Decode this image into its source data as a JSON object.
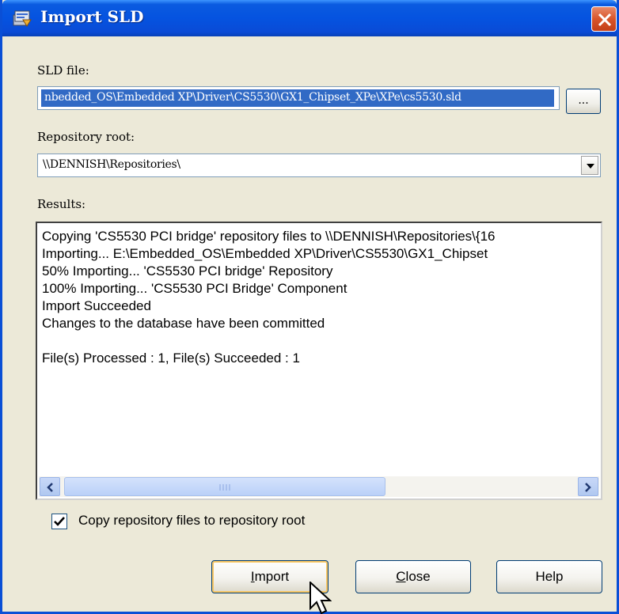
{
  "window": {
    "title": "Import SLD",
    "title_icon": "import-sld-icon",
    "close_icon": "close-icon"
  },
  "sld_file": {
    "label": "SLD file:",
    "value": "nbedded_OS\\Embedded XP\\Driver\\CS5530\\GX1_Chipset_XPe\\XPe\\cs5530.sld",
    "browse_label": "..."
  },
  "repository_root": {
    "label": "Repository root:",
    "value": "\\\\DENNISH\\Repositories\\"
  },
  "results": {
    "label": "Results:",
    "lines": [
      "Copying 'CS5530 PCI bridge' repository files to \\\\DENNISH\\Repositories\\{16",
      "Importing...  E:\\Embedded_OS\\Embedded XP\\Driver\\CS5530\\GX1_Chipset",
      "50% Importing...  'CS5530 PCI bridge' Repository",
      "100% Importing...  'CS5530 PCI Bridge' Component",
      "Import Succeeded",
      "Changes to the database have been committed",
      "",
      "File(s) Processed : 1, File(s) Succeeded : 1"
    ]
  },
  "copy_checkbox": {
    "label": "Copy repository files to repository root",
    "checked": true
  },
  "buttons": {
    "import": "Import",
    "close": "Close",
    "help": "Help"
  },
  "colors": {
    "titlebar": "#0553e0",
    "dialog_bg": "#ece9d8",
    "selection": "#316ac5",
    "close_button": "#d8552a"
  }
}
